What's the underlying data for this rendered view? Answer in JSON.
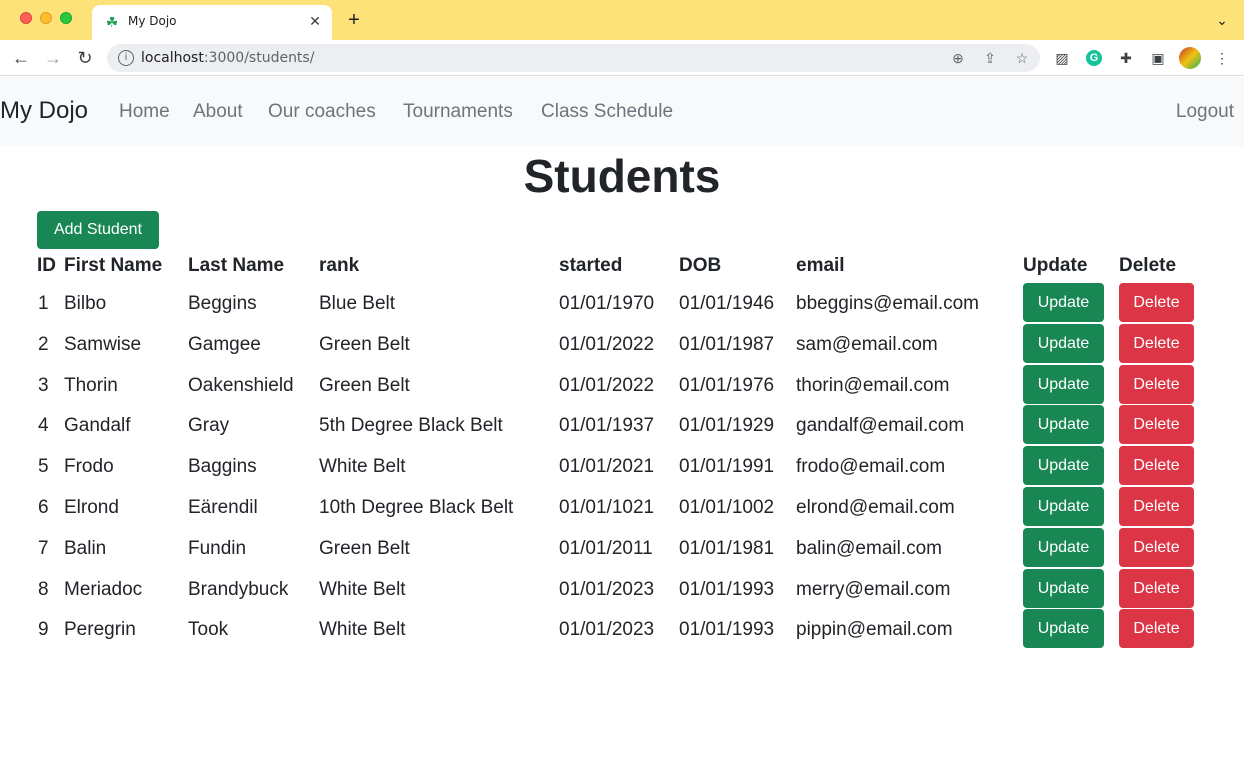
{
  "browser": {
    "tab_title": "My Dojo",
    "url_host": "localhost",
    "url_rest": ":3000/students/"
  },
  "navbar": {
    "brand": "My Dojo",
    "links": [
      "Home",
      "About",
      "Our coaches",
      "Tournaments",
      "Class Schedule"
    ],
    "logout": "Logout"
  },
  "page": {
    "title": "Students",
    "add_button": "Add Student"
  },
  "table": {
    "headers": [
      "ID",
      "First Name",
      "Last Name",
      "rank",
      "started",
      "DOB",
      "email",
      "Update",
      "Delete"
    ],
    "update_label": "Update",
    "delete_label": "Delete",
    "rows": [
      [
        "1",
        "Bilbo",
        "Beggins",
        "Blue Belt",
        "01/01/1970",
        "01/01/1946",
        "bbeggins@email.com"
      ],
      [
        "2",
        "Samwise",
        "Gamgee",
        "Green Belt",
        "01/01/2022",
        "01/01/1987",
        "sam@email.com"
      ],
      [
        "3",
        "Thorin",
        "Oakenshield",
        "Green Belt",
        "01/01/2022",
        "01/01/1976",
        "thorin@email.com"
      ],
      [
        "4",
        "Gandalf",
        "Gray",
        "5th Degree Black Belt",
        "01/01/1937",
        "01/01/1929",
        "gandalf@email.com"
      ],
      [
        "5",
        "Frodo",
        "Baggins",
        "White Belt",
        "01/01/2021",
        "01/01/1991",
        "frodo@email.com"
      ],
      [
        "6",
        "Elrond",
        "Eärendil",
        "10th Degree Black Belt",
        "01/01/1021",
        "01/01/1002",
        "elrond@email.com"
      ],
      [
        "7",
        "Balin",
        "Fundin",
        "Green Belt",
        "01/01/2011",
        "01/01/1981",
        "balin@email.com"
      ],
      [
        "8",
        "Meriadoc",
        "Brandybuck",
        "White Belt",
        "01/01/2023",
        "01/01/1993",
        "merry@email.com"
      ],
      [
        "9",
        "Peregrin",
        "Took",
        "White Belt",
        "01/01/2023",
        "01/01/1993",
        "pippin@email.com"
      ]
    ]
  }
}
